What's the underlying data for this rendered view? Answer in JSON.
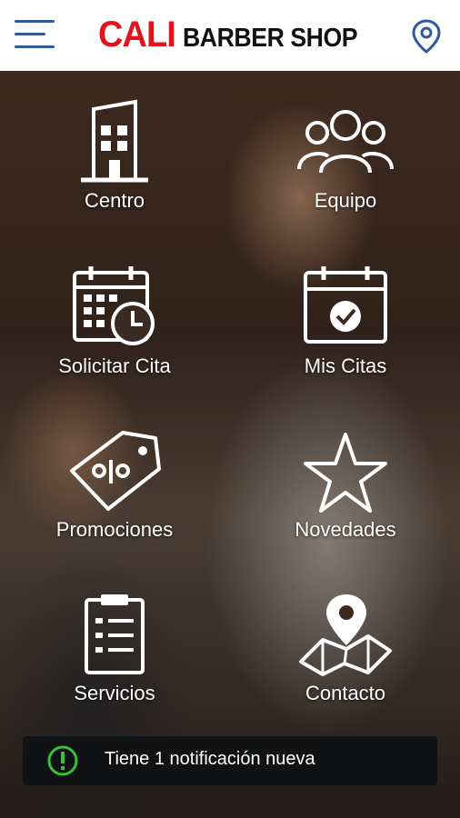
{
  "header": {
    "brand_highlight": "CALI",
    "brand_rest": "BARBER SHOP"
  },
  "menu": {
    "items": [
      {
        "label": "Centro",
        "icon": "building-icon"
      },
      {
        "label": "Equipo",
        "icon": "team-icon"
      },
      {
        "label": "Solicitar Cita",
        "icon": "calendar-clock-icon"
      },
      {
        "label": "Mis Citas",
        "icon": "calendar-check-icon"
      },
      {
        "label": "Promociones",
        "icon": "discount-tag-icon"
      },
      {
        "label": "Novedades",
        "icon": "star-icon"
      },
      {
        "label": "Servicios",
        "icon": "clipboard-list-icon"
      },
      {
        "label": "Contacto",
        "icon": "map-pin-icon"
      }
    ]
  },
  "notification": {
    "text": "Tiene 1 notificación nueva",
    "icon": "alert-icon"
  },
  "colors": {
    "brand_red": "#e1131c",
    "accent_blue": "#2f5b9a",
    "alert_green": "#3bbf3a"
  }
}
